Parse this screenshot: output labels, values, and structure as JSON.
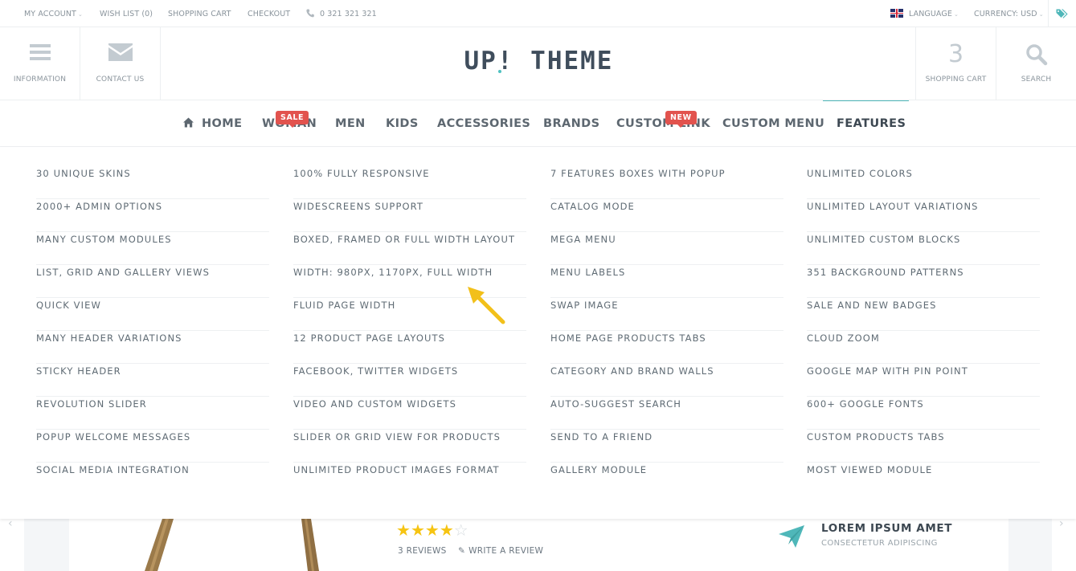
{
  "topbar": {
    "my_account": "MY ACCOUNT",
    "wish_list": "WISH LIST (0)",
    "shopping_cart": "SHOPPING CART",
    "checkout": "CHECKOUT",
    "phone": "0 321 321 321",
    "language": "LANGUAGE",
    "currency": "CURRENCY: USD"
  },
  "header": {
    "information": "INFORMATION",
    "contact_us": "CONTACT US",
    "logo": "UP! THEME",
    "cart_count": "3",
    "shopping_cart": "SHOPPING CART",
    "search": "SEARCH"
  },
  "nav": {
    "home": "HOME",
    "woman": "WOMAN",
    "woman_badge": "SALE",
    "men": "MEN",
    "kids": "KIDS",
    "accessories": "ACCESSORIES",
    "brands": "BRANDS",
    "custom_link": "CUSTOM LINK",
    "custom_link_badge": "NEW",
    "custom_menu": "CUSTOM MENU",
    "features": "FEATURES"
  },
  "mega_menu": {
    "col1": [
      "30 UNIQUE SKINS",
      "2000+ ADMIN OPTIONS",
      "MANY CUSTOM MODULES",
      "LIST, GRID AND GALLERY VIEWS",
      "QUICK VIEW",
      "MANY HEADER VARIATIONS",
      "STICKY HEADER",
      "REVOLUTION SLIDER",
      "POPUP WELCOME MESSAGES",
      "SOCIAL MEDIA INTEGRATION"
    ],
    "col2": [
      "100% FULLY RESPONSIVE",
      "WIDESCREENS SUPPORT",
      "BOXED, FRAMED OR FULL WIDTH LAYOUT",
      "WIDTH: 980PX, 1170PX, FULL WIDTH",
      "FLUID PAGE WIDTH",
      "12 PRODUCT PAGE LAYOUTS",
      "FACEBOOK, TWITTER WIDGETS",
      "VIDEO AND CUSTOM WIDGETS",
      "SLIDER OR GRID VIEW FOR PRODUCTS",
      "UNLIMITED PRODUCT IMAGES FORMAT"
    ],
    "col3": [
      "7 FEATURES BOXES WITH POPUP",
      "CATALOG MODE",
      "MEGA MENU",
      "MENU LABELS",
      "SWAP IMAGE",
      "HOME PAGE PRODUCTS TABS",
      "CATEGORY AND BRAND WALLS",
      "AUTO-SUGGEST SEARCH",
      "SEND TO A FRIEND",
      "GALLERY MODULE"
    ],
    "col4": [
      "UNLIMITED COLORS",
      "UNLIMITED LAYOUT VARIATIONS",
      "UNLIMITED CUSTOM BLOCKS",
      "351 BACKGROUND PATTERNS",
      "SALE AND NEW BADGES",
      "CLOUD ZOOM",
      "GOOGLE MAP WITH PIN POINT",
      "600+ GOOGLE FONTS",
      "CUSTOM PRODUCTS TABS",
      "MOST VIEWED MODULE"
    ]
  },
  "product": {
    "rating": 4,
    "rating_max": 5,
    "reviews": "3 REVIEWS",
    "write_review": "WRITE A REVIEW"
  },
  "promo": {
    "title": "LOREM IPSUM AMET",
    "subtitle": "CONSECTETUR ADIPISCING"
  },
  "colors": {
    "accent": "#4fb7b9",
    "badge": "#e2534e",
    "star": "#f6c412",
    "pointer_arrow": "#f2c01a"
  }
}
